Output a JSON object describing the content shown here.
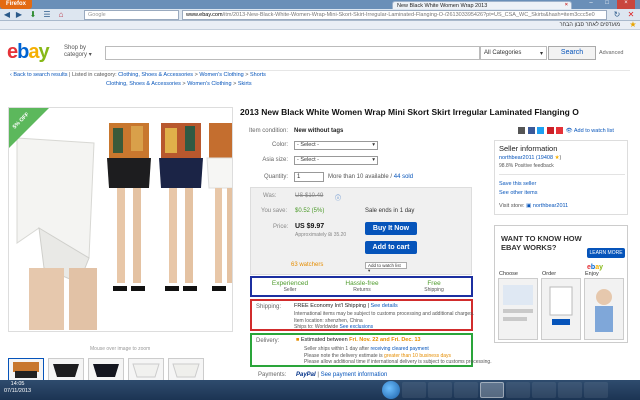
{
  "browser": {
    "menu_label": "Firefox",
    "tab_title": "New Black White Women Wrap 2013",
    "url_domain": "www.ebay.com",
    "url_rest": "/itm/2013-New-Black-White-Women-Wrap-Mini-Skort-Skirt-Irregular-Laminated-Flanging-O-/261303395426?pt=US_CSA_WC_Skirts&hash=item3ccc5e0",
    "search_placeholder": "Google",
    "bookmark_text": "מועדפים  לאתר  סבון הבחר"
  },
  "header": {
    "shop_by": "Shop by",
    "category": "category",
    "category_select": "All Categories",
    "search_button": "Search",
    "advanced": "Advanced"
  },
  "breadcrumbs": {
    "back": "Back to search results",
    "listed_in": "Listed in category:",
    "items": [
      "Clothing, Shoes & Accessories",
      "Women's Clothing",
      "Shorts"
    ],
    "second_line": [
      "Clothing, Shoes & Accessories",
      "Women's Clothing",
      "Skirts"
    ]
  },
  "image": {
    "ribbon": "5% OFF",
    "mouse_hint": "Mouse over image to zoom"
  },
  "product": {
    "title": "2013 New Black White Women Wrap Mini Skort Skirt Irregular Laminated Flanging O",
    "condition_label": "Item condition:",
    "condition_value": "New without tags",
    "color_label": "Color:",
    "color_value": "- Select -",
    "size_label": "Asia size:",
    "size_value": "- Select -",
    "quantity_label": "Quantity:",
    "quantity_value": "1",
    "available": "More than 10 available",
    "sold": "44 sold",
    "was_label": "Was:",
    "was_value": "US $10.49",
    "save_label": "You save:",
    "save_value": "$0.52 (5%)",
    "ends": "Sale ends in 1 day",
    "price_label": "Price:",
    "price_value": "US $9.97",
    "approx": "Approximately ₪ 35.20",
    "buy_now": "Buy It Now",
    "add_to_cart": "Add to cart",
    "watchers": "63 watchers",
    "add_watch": "Add to watch list"
  },
  "features": [
    {
      "title": "Experienced",
      "sub": "Seller"
    },
    {
      "title": "Hassle-free",
      "sub": "Returns"
    },
    {
      "title": "Free",
      "sub": "Shipping"
    }
  ],
  "shipping": {
    "label": "Shipping:",
    "line1": "FREE  Economy Int'l Shipping",
    "see_details": "See details",
    "line2": "International items may be subject to customs processing and additional charges.",
    "line3": "Item location:  shenzhen, China",
    "line4": "Ships to: Worldwide",
    "see_exclusions": "See exclusions"
  },
  "delivery": {
    "label": "Delivery:",
    "estimated": "Estimated between",
    "dates": "Fri. Nov. 22 and Fri. Dec. 13",
    "line2": "Seller ships within 1 day after",
    "cleared": "receiving cleared payment",
    "line3": "Please note the delivery estimate is",
    "greater": "greater than 10 business days",
    "line4": "Please allow additional time if international delivery is subject to customs processing."
  },
  "payments": {
    "label": "Payments:",
    "paypal": "PayPal",
    "see_info": "See payment information"
  },
  "share": {
    "add_watch": "Add to watch list"
  },
  "seller": {
    "heading": "Seller information",
    "name": "northbear2011",
    "score": "(19408",
    "feedback": "98.8% Positive feedback",
    "save": "Save this seller",
    "other": "See other items",
    "visit_label": "Visit store:",
    "store": "northbear2011"
  },
  "ad": {
    "title1": "WANT TO KNOW HOW",
    "title2": "EBAY WORKS?",
    "learn": "LEARN MORE",
    "steps": [
      "Choose",
      "Order",
      "Enjoy"
    ]
  },
  "taskbar": {
    "time": "14:05",
    "date": "07/11/2013"
  }
}
